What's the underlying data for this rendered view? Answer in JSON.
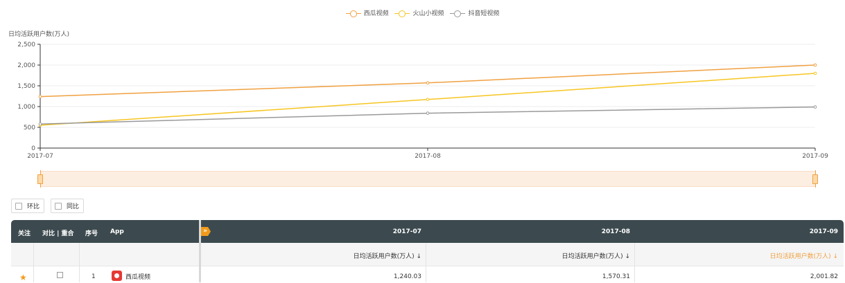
{
  "legend": [
    {
      "name": "西瓜视频",
      "color": "#f0a040"
    },
    {
      "name": "火山小视频",
      "color": "#f7c520"
    },
    {
      "name": "抖音短视频",
      "color": "#999999"
    }
  ],
  "chart_data": {
    "type": "line",
    "title": "",
    "ylabel": "日均活跃用户数(万人)",
    "xlabel": "",
    "x": [
      "2017-07",
      "2017-08",
      "2017-09"
    ],
    "ylim": [
      0,
      2500
    ],
    "yticks": [
      "0",
      "500",
      "1,000",
      "1,500",
      "2,000",
      "2,500"
    ],
    "ytick_values": [
      0,
      500,
      1000,
      1500,
      2000,
      2500
    ],
    "grid": true,
    "legend_position": "top-center",
    "series": [
      {
        "name": "西瓜视频",
        "color": "#f0a040",
        "values": [
          1240,
          1570,
          2000
        ]
      },
      {
        "name": "火山小视频",
        "color": "#f7c520",
        "values": [
          550,
          1170,
          1800
        ]
      },
      {
        "name": "抖音短视频",
        "color": "#999999",
        "values": [
          580,
          840,
          990
        ]
      }
    ]
  },
  "controls": {
    "mom_label": "环比",
    "yoy_label": "同比"
  },
  "table": {
    "headers": {
      "follow": "关注",
      "compare": "对比 | 重合",
      "index": "序号",
      "app": "App",
      "expand_icon": "»",
      "months": [
        "2017-07",
        "2017-08",
        "2017-09"
      ]
    },
    "metric_label": "日均活跃用户数(万人) ↓",
    "rows": [
      {
        "index": "1",
        "app": "西瓜视频",
        "values": [
          "1,240.03",
          "1,570.31",
          "2,001.82"
        ]
      }
    ]
  }
}
